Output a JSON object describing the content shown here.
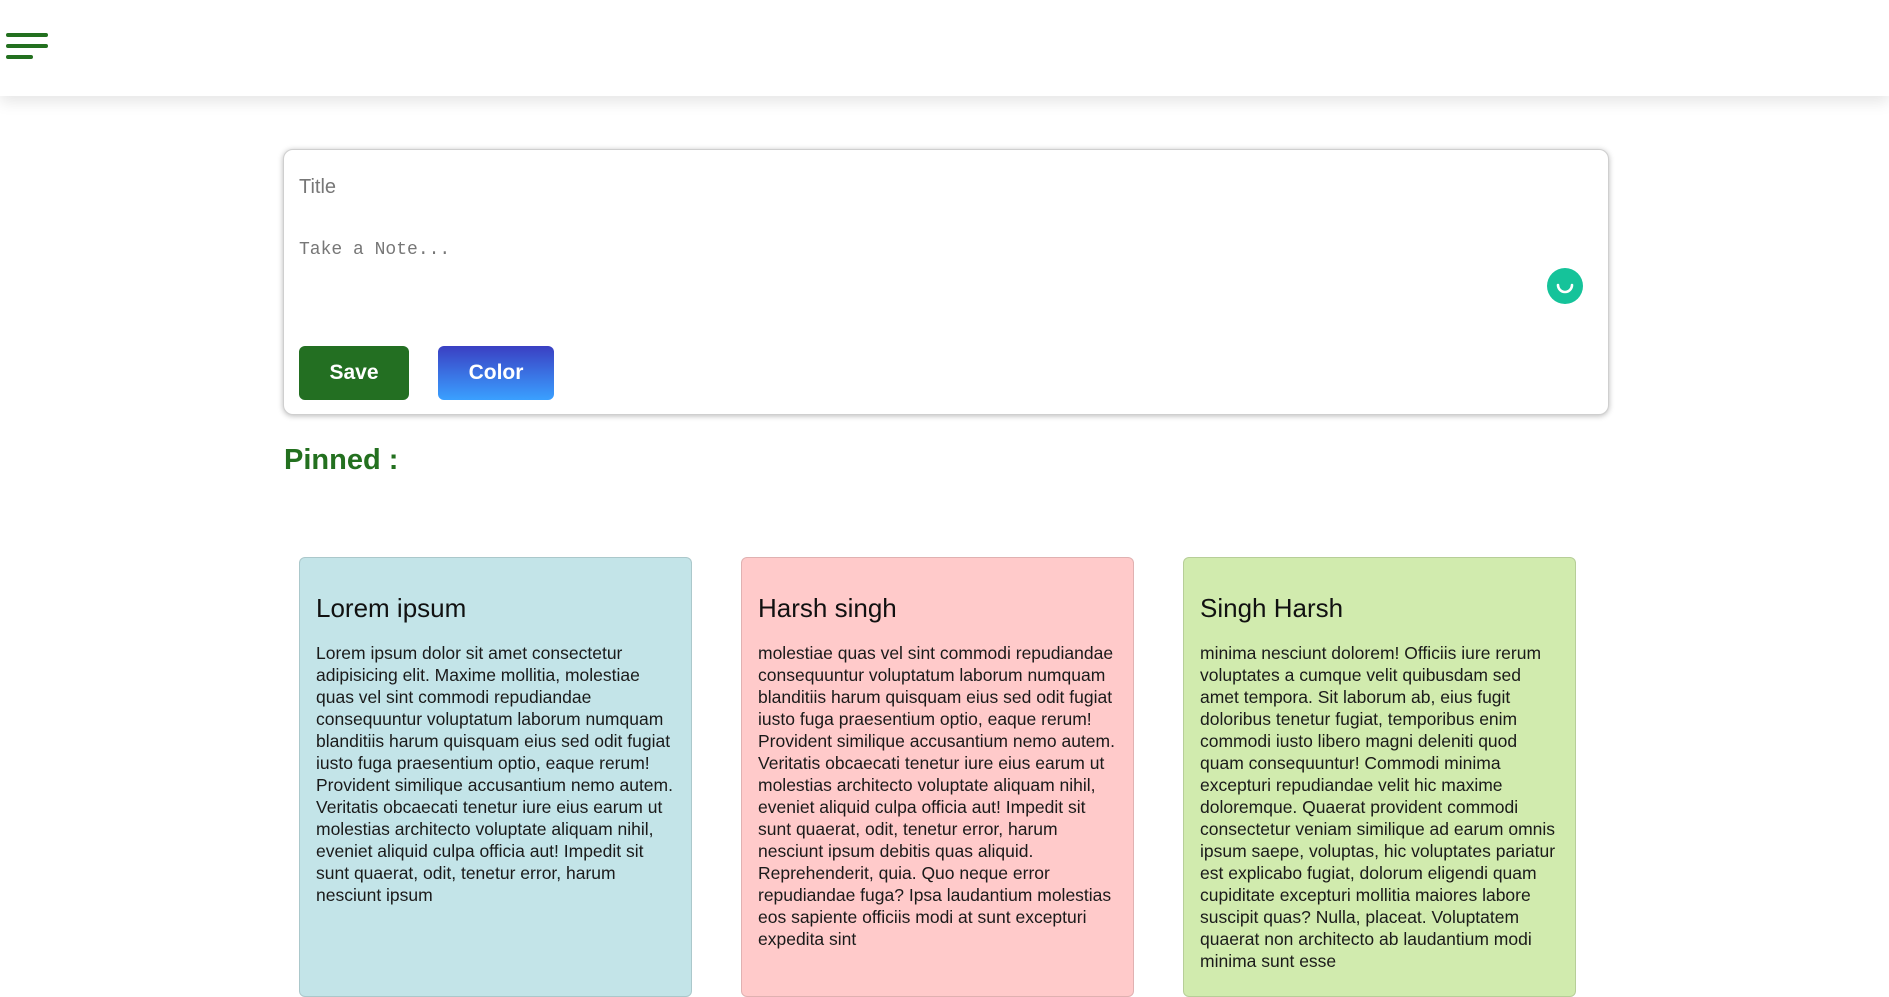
{
  "header": {
    "menu_icon": "hamburger-menu-icon",
    "accent_color": "#23701f"
  },
  "composer": {
    "title_placeholder": "Title",
    "note_placeholder": "Take a Note...",
    "save_label": "Save",
    "color_label": "Color",
    "save_color": "#236f22",
    "color_button_gradient": [
      "#3a3fc2",
      "#3aa0ff"
    ],
    "grammar_icon": "grammarly-icon",
    "grammar_icon_color": "#15c39a"
  },
  "pinned": {
    "heading": "Pinned :"
  },
  "notes": [
    {
      "title": "Lorem ipsum",
      "color": "#c3e4e8",
      "body": "Lorem ipsum dolor sit amet consectetur adipisicing elit. Maxime mollitia, molestiae quas vel sint commodi repudiandae consequuntur voluptatum laborum numquam blanditiis harum quisquam eius sed odit fugiat iusto fuga praesentium optio, eaque rerum! Provident similique accusantium nemo autem. Veritatis obcaecati tenetur iure eius earum ut molestias architecto voluptate aliquam nihil, eveniet aliquid culpa officia aut! Impedit sit sunt quaerat, odit, tenetur error, harum nesciunt ipsum"
    },
    {
      "title": "Harsh singh",
      "color": "#ffcaca",
      "body": "molestiae quas vel sint commodi repudiandae consequuntur voluptatum laborum numquam blanditiis harum quisquam eius sed odit fugiat iusto fuga praesentium optio, eaque rerum! Provident similique accusantium nemo autem. Veritatis obcaecati tenetur iure eius earum ut molestias architecto voluptate aliquam nihil, eveniet aliquid culpa officia aut! Impedit sit sunt quaerat, odit, tenetur error, harum nesciunt ipsum debitis quas aliquid. Reprehenderit, quia. Quo neque error repudiandae fuga? Ipsa laudantium molestias eos sapiente officiis modi at sunt excepturi expedita sint"
    },
    {
      "title": "Singh Harsh",
      "color": "#d1ebae",
      "body": "minima nesciunt dolorem! Officiis iure rerum voluptates a cumque velit quibusdam sed amet tempora. Sit laborum ab, eius fugit doloribus tenetur fugiat, temporibus enim commodi iusto libero magni deleniti quod quam consequuntur! Commodi minima excepturi repudiandae velit hic maxime doloremque. Quaerat provident commodi consectetur veniam similique ad earum omnis ipsum saepe, voluptas, hic voluptates pariatur est explicabo fugiat, dolorum eligendi quam cupiditate excepturi mollitia maiores labore suscipit quas? Nulla, placeat. Voluptatem quaerat non architecto ab laudantium modi minima sunt esse"
    }
  ]
}
